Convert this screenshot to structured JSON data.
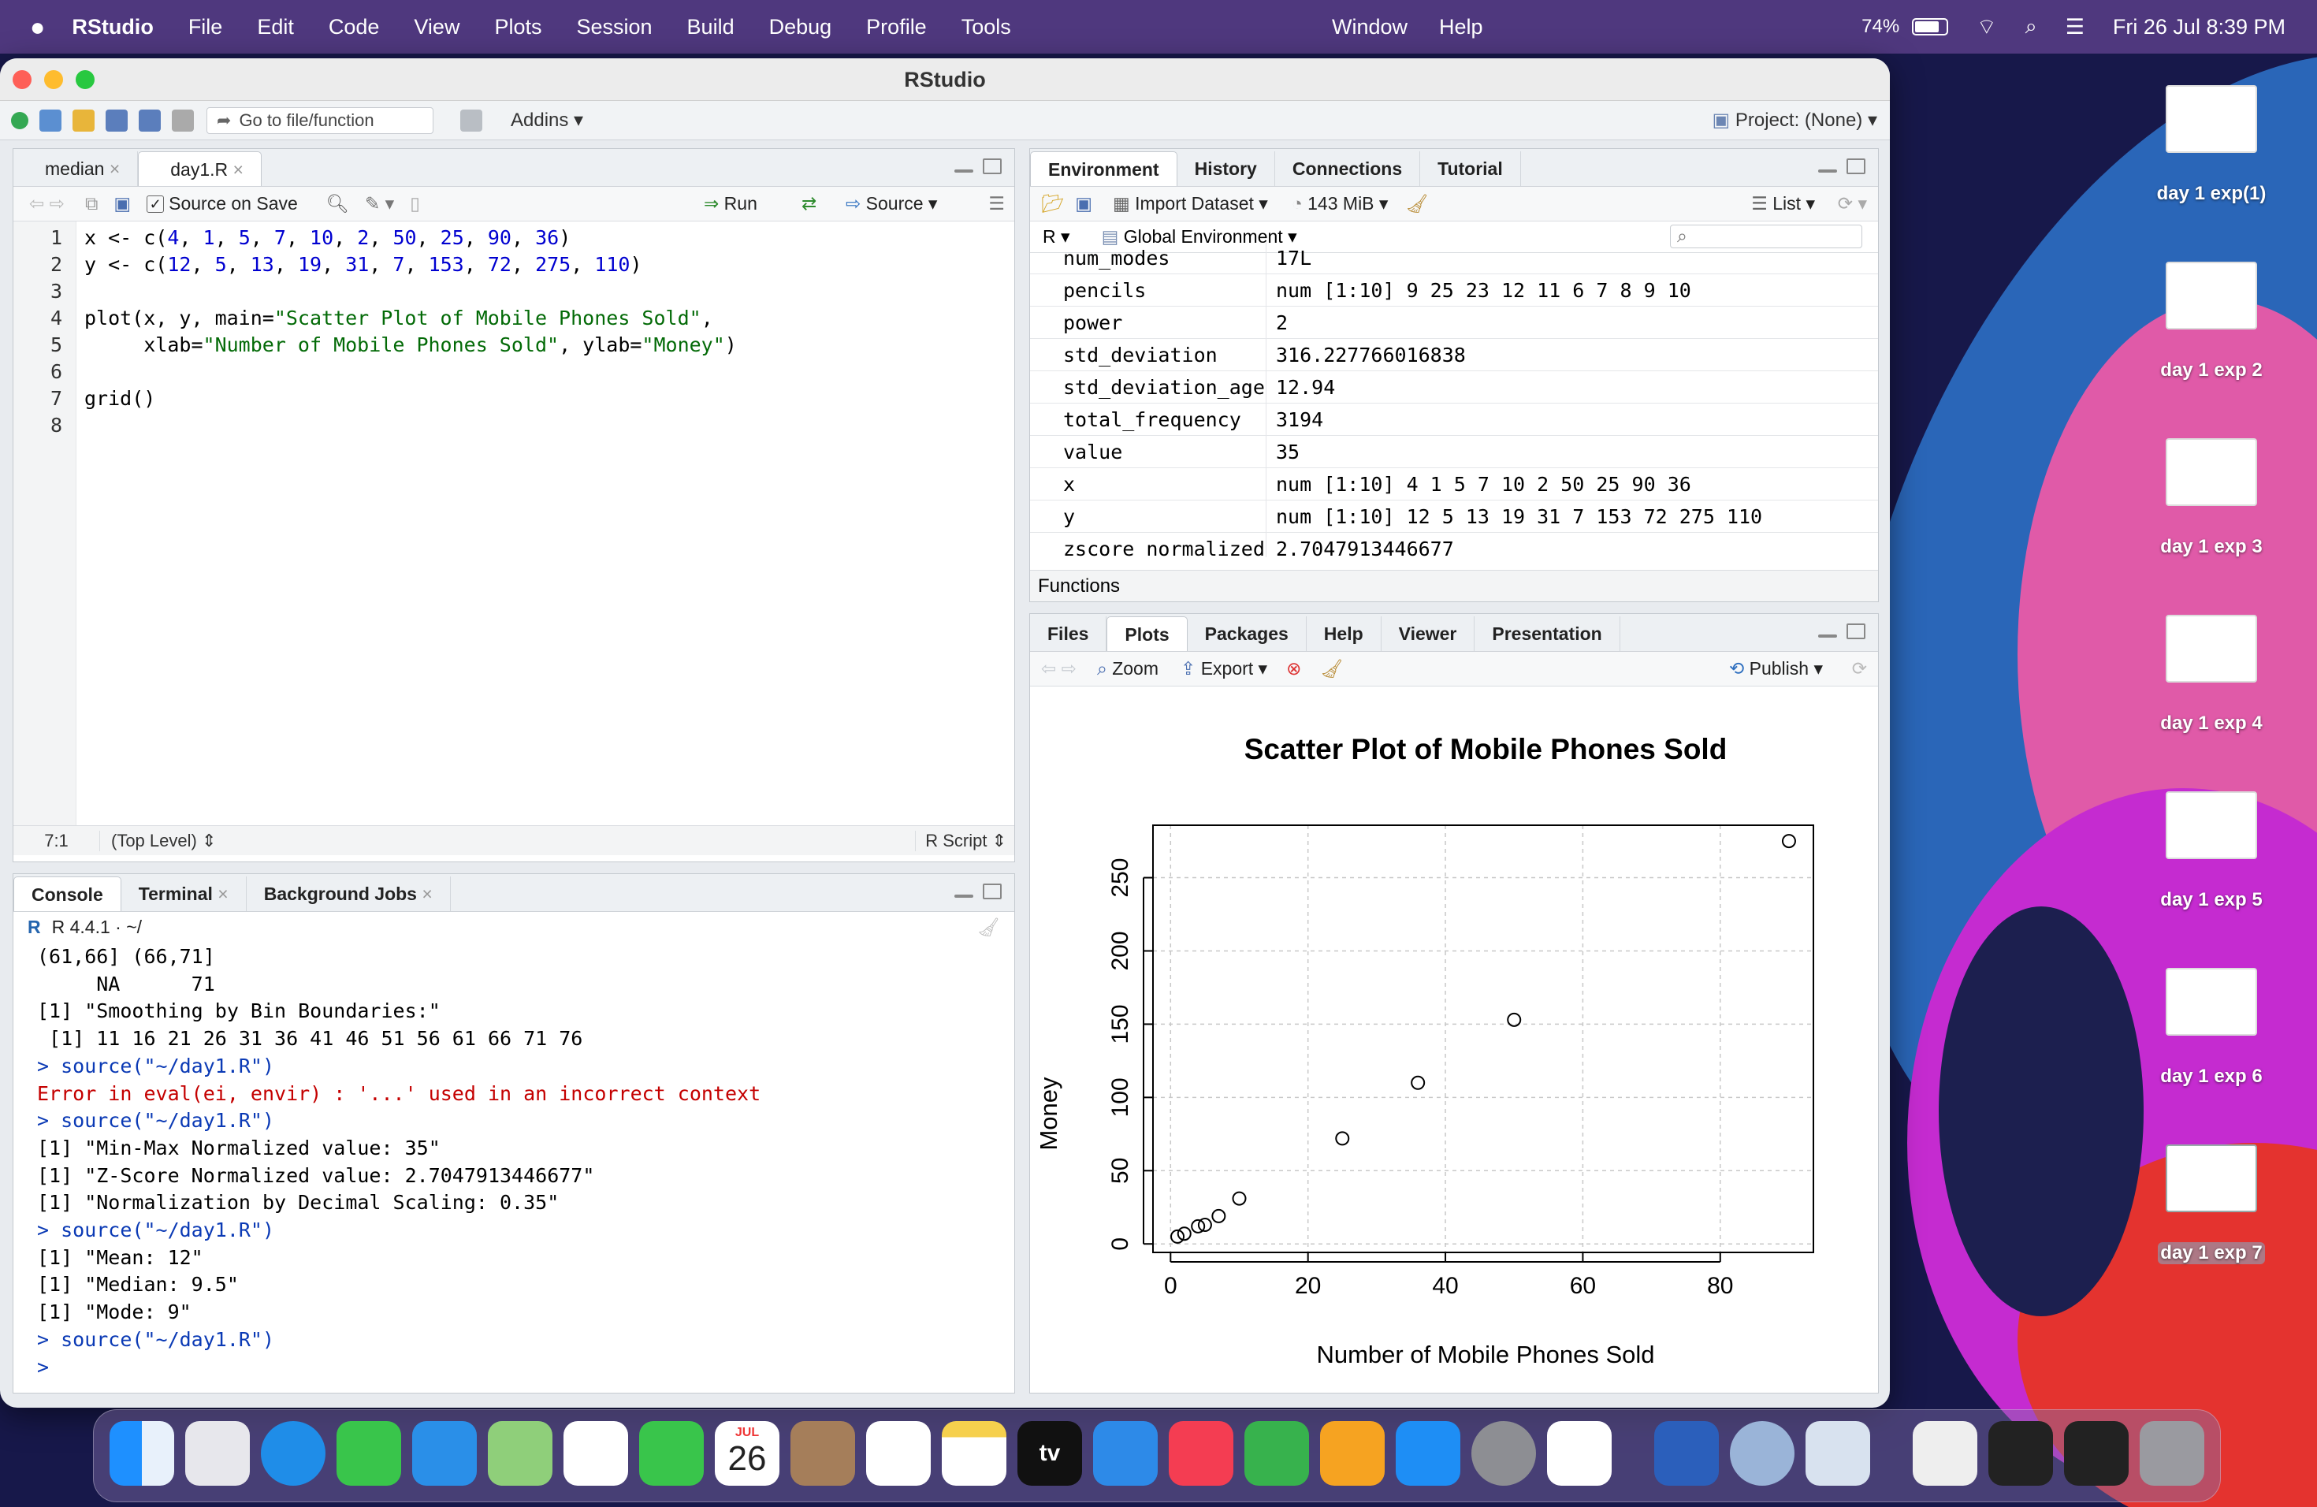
{
  "menubar": {
    "app": "RStudio",
    "items": [
      "File",
      "Edit",
      "Code",
      "View",
      "Plots",
      "Session",
      "Build",
      "Debug",
      "Profile",
      "Tools"
    ],
    "items_right": [
      "Window",
      "Help"
    ],
    "battery": "74%",
    "datetime": "Fri 26 Jul  8:39 PM"
  },
  "window": {
    "title": "RStudio",
    "toolbar": {
      "goto_placeholder": "Go to file/function",
      "addins": "Addins",
      "project": "Project: (None)"
    }
  },
  "editor": {
    "tabs": [
      "median",
      "day1.R"
    ],
    "source_on_save": "Source on Save",
    "run": "Run",
    "source": "Source",
    "status_pos": "7:1",
    "status_scope": "(Top Level)",
    "status_type": "R Script",
    "line_numbers": [
      "1",
      "2",
      "3",
      "4",
      "5",
      "6",
      "7",
      "8"
    ]
  },
  "console": {
    "tabs": [
      "Console",
      "Terminal",
      "Background Jobs"
    ],
    "r_version": "R 4.4.1 · ~/",
    "lines": [
      {
        "t": "(61,66] (66,71]",
        "c": ""
      },
      {
        "t": "     NA      71",
        "c": ""
      },
      {
        "t": "[1] \"Smoothing by Bin Boundaries:\"",
        "c": ""
      },
      {
        "t": " [1] 11 16 21 26 31 36 41 46 51 56 61 66 71 76",
        "c": ""
      },
      {
        "t": "> source(\"~/day1.R\")",
        "c": "blue"
      },
      {
        "t": "Error in eval(ei, envir) : '...' used in an incorrect context",
        "c": "red"
      },
      {
        "t": "> source(\"~/day1.R\")",
        "c": "blue"
      },
      {
        "t": "[1] \"Min-Max Normalized value: 35\"",
        "c": ""
      },
      {
        "t": "[1] \"Z-Score Normalized value: 2.7047913446677\"",
        "c": ""
      },
      {
        "t": "[1] \"Normalization by Decimal Scaling: 0.35\"",
        "c": ""
      },
      {
        "t": "> source(\"~/day1.R\")",
        "c": "blue"
      },
      {
        "t": "[1] \"Mean: 12\"",
        "c": ""
      },
      {
        "t": "[1] \"Median: 9.5\"",
        "c": ""
      },
      {
        "t": "[1] \"Mode: 9\"",
        "c": ""
      },
      {
        "t": "> source(\"~/day1.R\")",
        "c": "blue"
      },
      {
        "t": "> ",
        "c": "blue"
      }
    ]
  },
  "environment": {
    "tabs": [
      "Environment",
      "History",
      "Connections",
      "Tutorial"
    ],
    "import_dataset": "Import Dataset",
    "memory": "143 MiB",
    "list": "List",
    "lang": "R",
    "scope": "Global Environment",
    "rows": [
      {
        "name": "num_modes",
        "value": "17L"
      },
      {
        "name": "pencils",
        "value": "num [1:10] 9 25 23 12 11 6 7 8 9 10"
      },
      {
        "name": "power",
        "value": "2"
      },
      {
        "name": "std_deviation",
        "value": "316.227766016838"
      },
      {
        "name": "std_deviation_age",
        "value": "12.94"
      },
      {
        "name": "total_frequency",
        "value": "3194"
      },
      {
        "name": "value",
        "value": "35"
      },
      {
        "name": "x",
        "value": "num [1:10] 4 1 5 7 10 2 50 25 90 36"
      },
      {
        "name": "y",
        "value": "num [1:10] 12 5 13 19 31 7 153 72 275 110"
      },
      {
        "name": "zscore_normalized",
        "value": "2.7047913446677"
      }
    ],
    "section": "Functions"
  },
  "plots": {
    "tabs": [
      "Files",
      "Plots",
      "Packages",
      "Help",
      "Viewer",
      "Presentation"
    ],
    "zoom": "Zoom",
    "export": "Export",
    "publish": "Publish"
  },
  "chart_data": {
    "type": "scatter",
    "title": "Scatter Plot of Mobile Phones Sold",
    "xlabel": "Number of Mobile Phones Sold",
    "ylabel": "Money",
    "x": [
      4,
      1,
      5,
      7,
      10,
      2,
      50,
      25,
      90,
      36
    ],
    "y": [
      12,
      5,
      13,
      19,
      31,
      7,
      153,
      72,
      275,
      110
    ],
    "xticks": [
      0,
      20,
      40,
      60,
      80
    ],
    "yticks": [
      0,
      50,
      100,
      150,
      200,
      250
    ],
    "xlim": [
      -2.56,
      93.56
    ],
    "ylim": [
      -5.8,
      285.8
    ],
    "grid": true
  },
  "desktop_thumbs": [
    "day 1 exp(1)",
    "day 1 exp 2",
    "day 1 exp 3",
    "day 1 exp 4",
    "day 1 exp 5",
    "day 1 exp 6",
    "day 1 exp 7"
  ],
  "dock": {
    "calendar_month": "JUL",
    "calendar_day": "26",
    "tv_label": "tv"
  }
}
